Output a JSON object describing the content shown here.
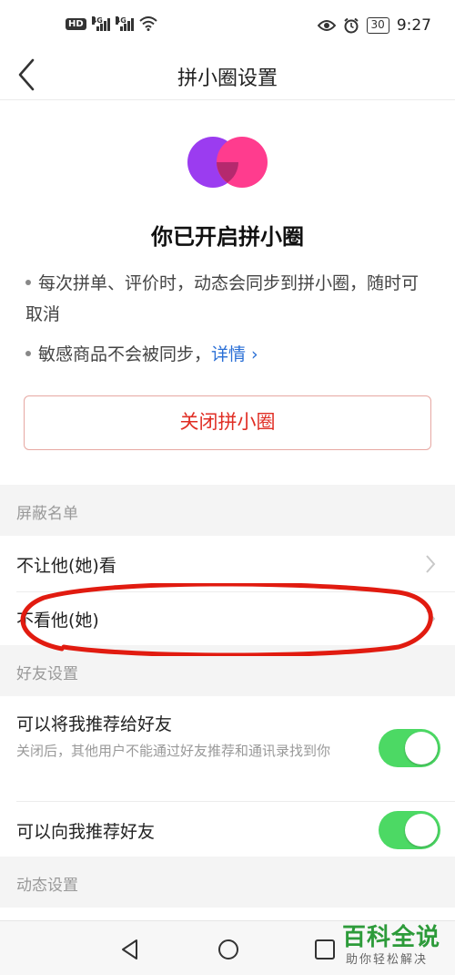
{
  "status_bar": {
    "hd_badge": "HD",
    "network_1": "4G",
    "network_2": "4G",
    "battery": "30",
    "time": "9:27"
  },
  "header": {
    "title": "拼小圈设置",
    "back_icon": "back-arrow-icon"
  },
  "hero": {
    "title": "你已开启拼小圈",
    "bullets": [
      "每次拼单、评价时，动态会同步到拼小圈，随时可取消",
      "敏感商品不会被同步，"
    ],
    "detail_link": "详情 ›",
    "close_button": "关闭拼小圈",
    "logo_colors": {
      "left": "#9b3cf0",
      "right": "#ff3c8e",
      "overlap": "#b5296e"
    }
  },
  "block_list": {
    "header": "屏蔽名单",
    "items": [
      {
        "label": "不让他(她)看"
      },
      {
        "label": "不看他(她)"
      }
    ]
  },
  "friend_settings": {
    "header": "好友设置",
    "items": [
      {
        "label": "可以将我推荐给好友",
        "sub": "关闭后，其他用户不能通过好友推荐和通讯录找到你",
        "enabled": true
      },
      {
        "label": "可以向我推荐好友",
        "enabled": true
      }
    ]
  },
  "moments_settings": {
    "header": "动态设置"
  },
  "watermark": {
    "title": "百科全说",
    "subtitle": "助你轻松解决"
  },
  "colors": {
    "accent_red": "#e02e24",
    "link_blue": "#2a6fd6",
    "toggle_green": "#4cd964"
  }
}
